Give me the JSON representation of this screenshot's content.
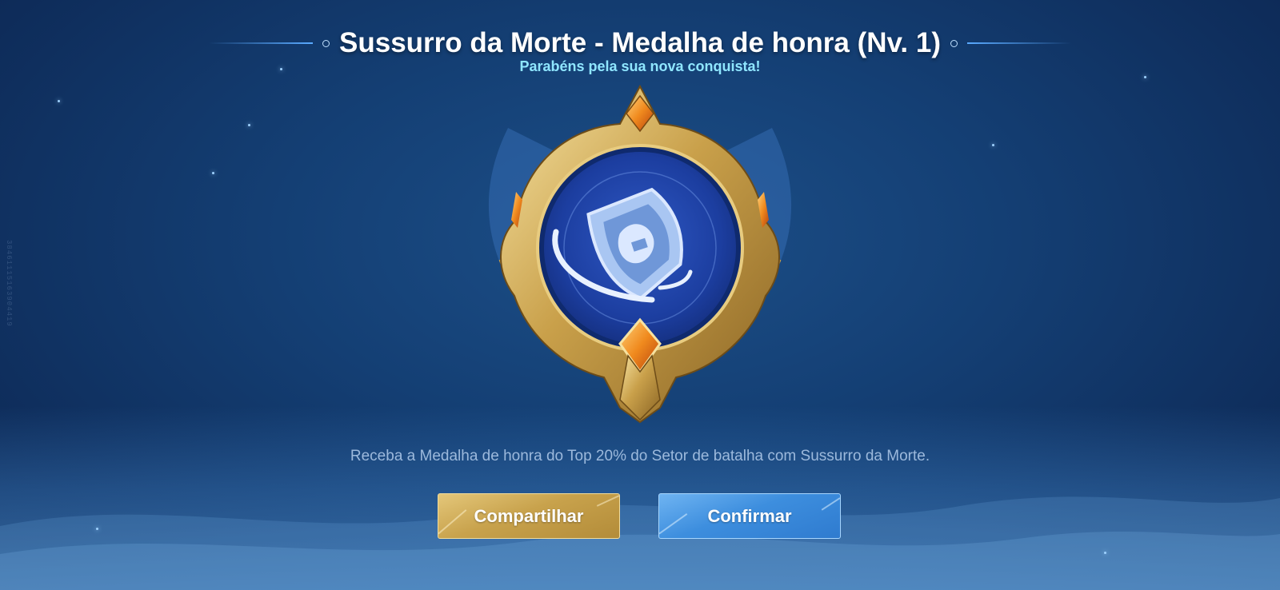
{
  "header": {
    "title": "Sussurro da Morte - Medalha de honra (Nv. 1)",
    "subtitle": "Parabéns pela sua nova conquista!"
  },
  "medal": {
    "icon": "shield-medal-icon",
    "name": "Sussurro da Morte",
    "level": 1
  },
  "description": "Receba a Medalha de honra do Top 20% do Setor de batalha com Sussurro da Morte.",
  "buttons": {
    "share_label": "Compartilhar",
    "confirm_label": "Confirmar"
  },
  "side_id": "38461115163904419",
  "colors": {
    "background": "#143f74",
    "subtitle": "#8fe6ff",
    "gold": "#c8a24c",
    "confirm_blue": "#3d8ede"
  }
}
